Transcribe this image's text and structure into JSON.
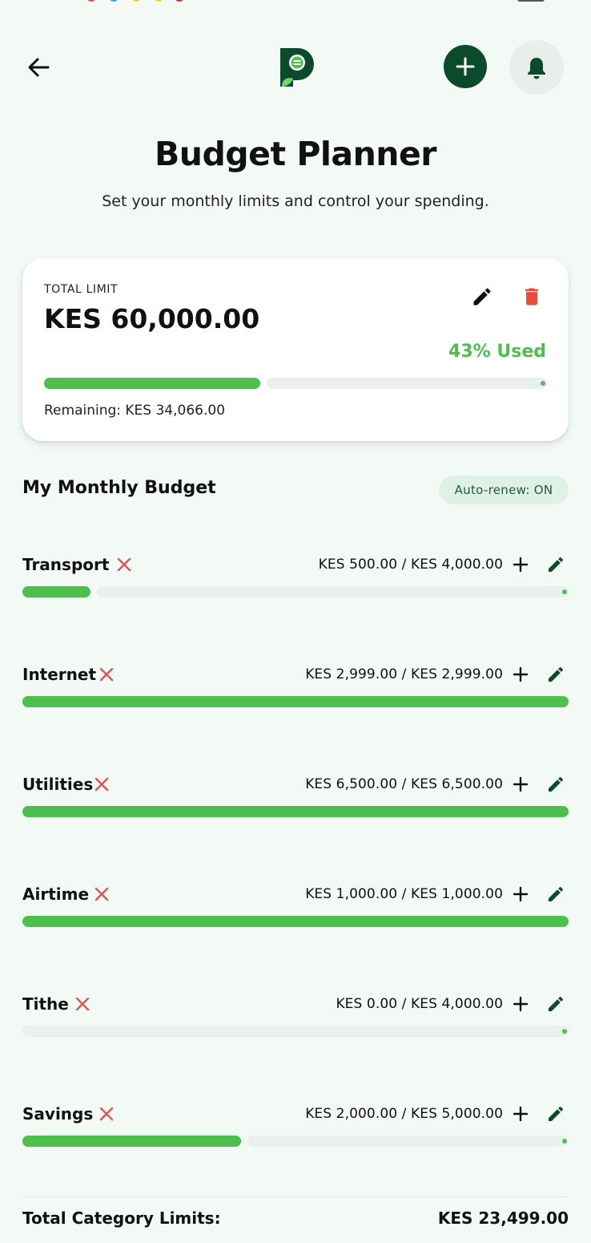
{
  "colors": {
    "accent_green": "#4cbf4c",
    "dark_green": "#0c4a2c",
    "remove_red": "#e05555",
    "trash_red": "#e74c3c"
  },
  "header": {
    "back_icon": "arrow-left-icon",
    "logo_icon": "p-leaf-logo-icon",
    "add_icon": "plus-icon",
    "bell_icon": "bell-icon"
  },
  "page": {
    "title": "Budget Planner",
    "subtitle": "Set your monthly limits and control your spending."
  },
  "total_card": {
    "label": "TOTAL LIMIT",
    "amount": "KES 60,000.00",
    "used_label": "43% Used",
    "used_fraction": 0.43,
    "remaining": "Remaining: KES 34,066.00"
  },
  "section": {
    "title": "My Monthly Budget",
    "auto_renew": "Auto-renew: ON"
  },
  "categories": [
    {
      "name": "Transport",
      "amounts": "KES 500.00 / KES 4,000.00",
      "progress": 0.125
    },
    {
      "name": "Internet",
      "amounts": "KES 2,999.00 / KES 2,999.00",
      "progress": 1.0
    },
    {
      "name": "Utilities",
      "amounts": "KES 6,500.00 / KES 6,500.00",
      "progress": 1.0
    },
    {
      "name": "Airtime",
      "amounts": "KES 1,000.00 / KES 1,000.00",
      "progress": 1.0
    },
    {
      "name": "Tithe",
      "amounts": "KES 0.00 / KES 4,000.00",
      "progress": 0.0
    },
    {
      "name": "Savings",
      "amounts": "KES 2,000.00 / KES 5,000.00",
      "progress": 0.4
    }
  ],
  "footer": {
    "total_label": "Total Category Limits:",
    "total_value": "KES 23,499.00"
  }
}
